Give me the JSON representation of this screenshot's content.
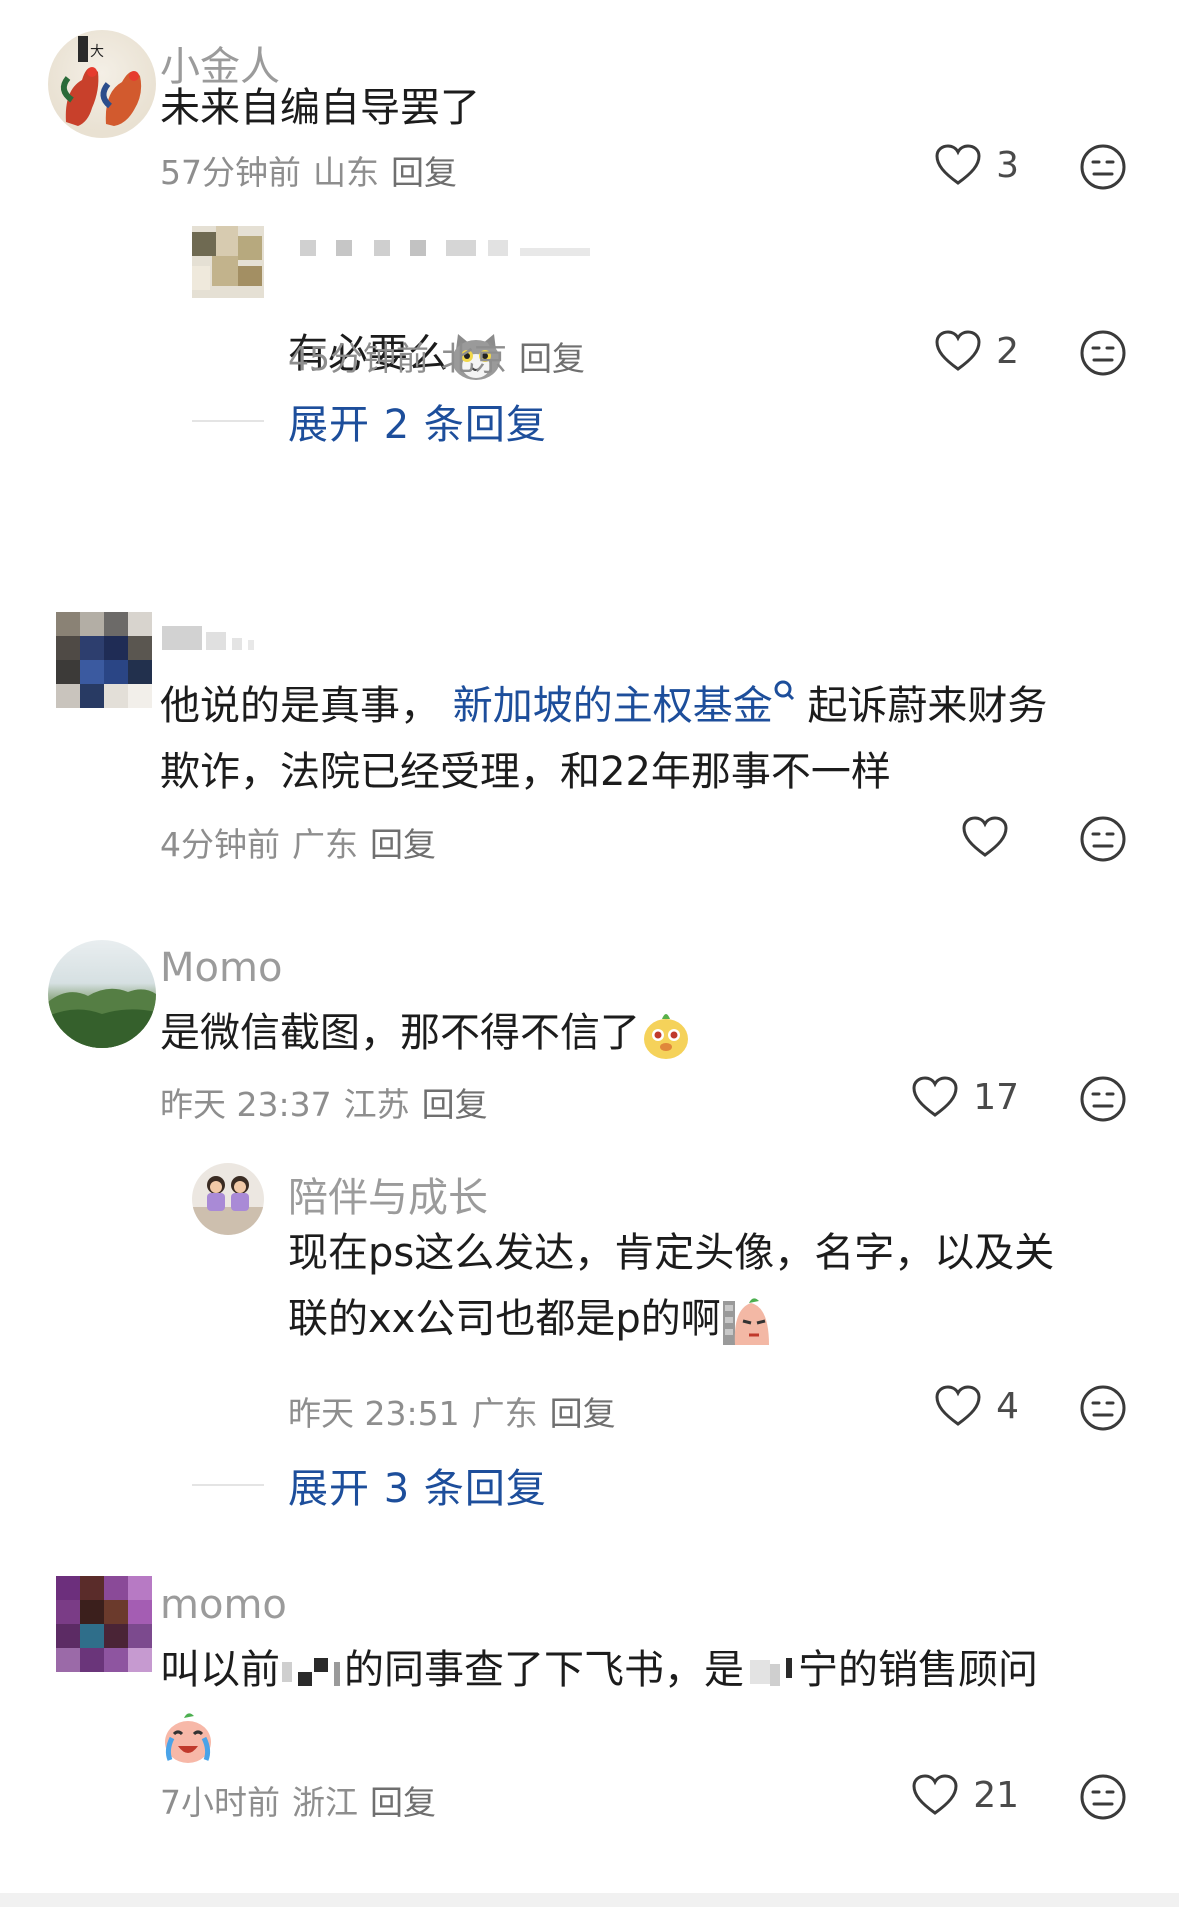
{
  "comments": [
    {
      "username": "小金人",
      "text": "未来自编自导罢了",
      "time": "57分钟前",
      "location": "山东",
      "reply_label": "回复",
      "likes": "3",
      "replies": [
        {
          "username": "",
          "text": "有必要么",
          "time": "45分钟前",
          "location": "北京",
          "reply_label": "回复",
          "likes": "2"
        }
      ],
      "expand_label": "展开 2 条回复"
    },
    {
      "username": "",
      "text_before_link": "他说的是真事，",
      "link": "新加坡的主权基金",
      "text_after_link": "起诉蔚来财务",
      "text_line2": "欺诈，法院已经受理，和22年那事不一样",
      "time": "4分钟前",
      "location": "广东",
      "reply_label": "回复",
      "likes": ""
    },
    {
      "username": "Momo",
      "text": "是微信截图，那不得不信了",
      "time": "昨天 23:37",
      "location": "江苏",
      "reply_label": "回复",
      "likes": "17",
      "replies": [
        {
          "username": "陪伴与成长",
          "text_line1": "现在ps这么发达，肯定头像，名字，以及关",
          "text_line2": "联的xx公司也都是p的啊",
          "time": "昨天 23:51",
          "location": "广东",
          "reply_label": "回复",
          "likes": "4"
        }
      ],
      "expand_label": "展开 3 条回复"
    },
    {
      "username": "momo",
      "text_part1": "叫以前",
      "text_part2": "的同事查了下飞书，是",
      "text_part3": "宁的销售顾问",
      "time": "7小时前",
      "location": "浙江",
      "reply_label": "回复",
      "likes": "21"
    }
  ],
  "icons": {
    "like": "heart-outline-icon",
    "dislike": "neutral-face-icon"
  },
  "colors": {
    "link": "#1d4e9b",
    "meta": "#8e8e8e",
    "username": "#9b9b9b"
  }
}
